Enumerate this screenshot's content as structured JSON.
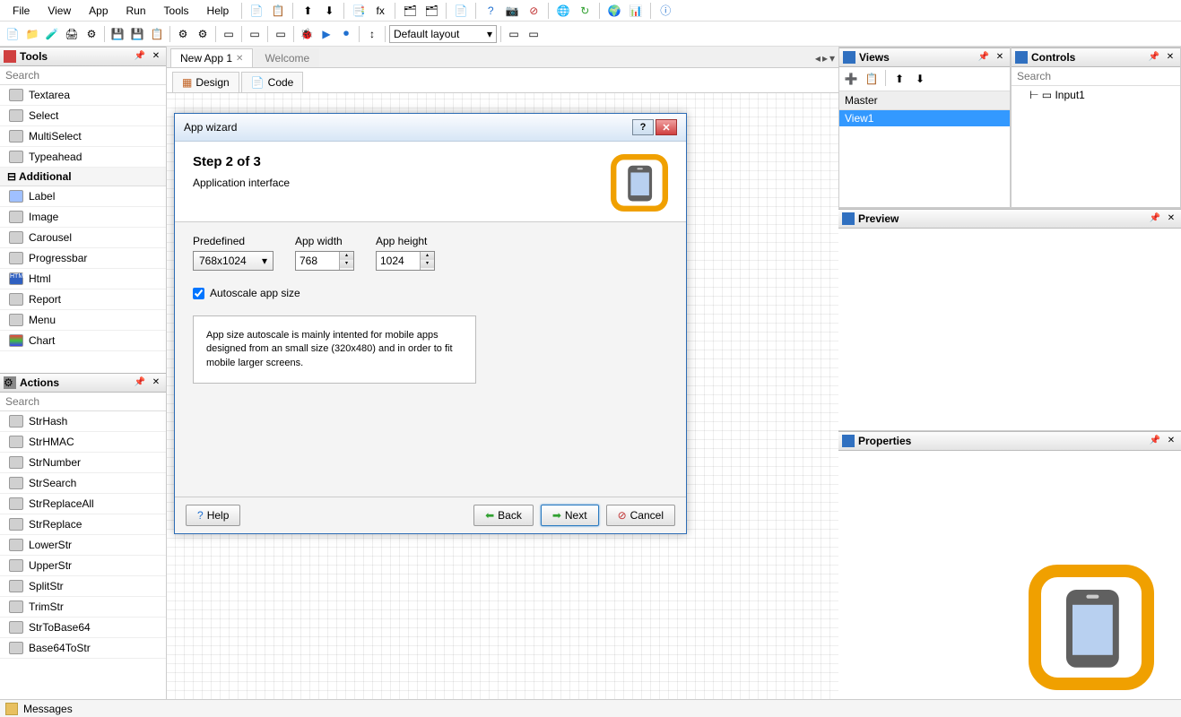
{
  "menu": [
    "File",
    "View",
    "App",
    "Run",
    "Tools",
    "Help"
  ],
  "layoutCombo": "Default layout",
  "toolsPanel": {
    "title": "Tools",
    "search": "Search",
    "items": [
      "Textarea",
      "Select",
      "MultiSelect",
      "Typeahead"
    ],
    "category": "Additional",
    "items2": [
      "Label",
      "Image",
      "Carousel",
      "Progressbar",
      "Html",
      "Report",
      "Menu",
      "Chart"
    ]
  },
  "actionsPanel": {
    "title": "Actions",
    "search": "Search",
    "items": [
      "StrHash",
      "StrHMAC",
      "StrNumber",
      "StrSearch",
      "StrReplaceAll",
      "StrReplace",
      "LowerStr",
      "UpperStr",
      "SplitStr",
      "TrimStr",
      "StrToBase64",
      "Base64ToStr"
    ]
  },
  "centerTabs": {
    "tab1": "New App 1",
    "tab2": "Welcome"
  },
  "subtabs": {
    "design": "Design",
    "code": "Code"
  },
  "dialog": {
    "title": "App wizard",
    "step": "Step 2 of 3",
    "subtitle": "Application interface",
    "labels": {
      "predefined": "Predefined",
      "appwidth": "App width",
      "appheight": "App height",
      "autoscale": "Autoscale app size"
    },
    "values": {
      "predefined": "768x1024",
      "appwidth": "768",
      "appheight": "1024",
      "autoscale": true
    },
    "note": "App size autoscale is mainly intented for mobile apps designed from an small size (320x480) and in order to fit mobile larger screens.",
    "buttons": {
      "help": "Help",
      "back": "Back",
      "next": "Next",
      "cancel": "Cancel"
    }
  },
  "viewsPanel": {
    "title": "Views",
    "master": "Master",
    "item": "View1"
  },
  "controlsPanel": {
    "title": "Controls",
    "search": "Search",
    "item": "Input1"
  },
  "previewPanel": {
    "title": "Preview"
  },
  "propsPanel": {
    "title": "Properties"
  },
  "status": {
    "messages": "Messages"
  }
}
